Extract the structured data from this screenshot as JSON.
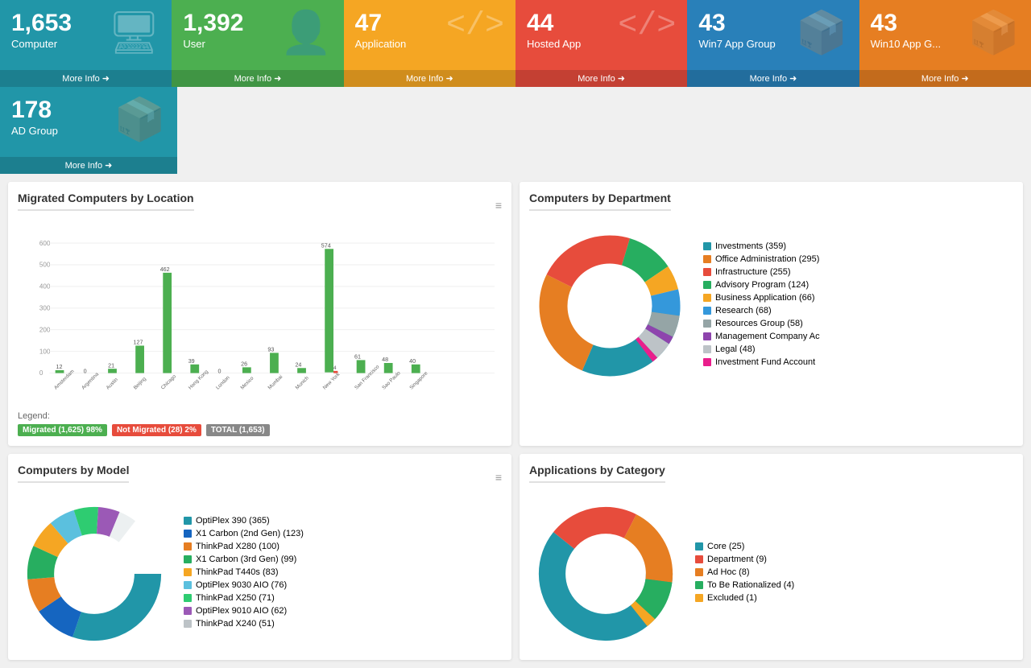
{
  "cards": [
    {
      "id": "computer",
      "number": "1,653",
      "label": "Computer",
      "color": "blue",
      "icon": "🖥",
      "more": "More Info"
    },
    {
      "id": "user",
      "number": "1,392",
      "label": "User",
      "color": "green",
      "icon": "👤",
      "more": "More Info"
    },
    {
      "id": "application",
      "number": "47",
      "label": "Application",
      "color": "yellow",
      "icon": "</>",
      "more": "More Info"
    },
    {
      "id": "hosted-app",
      "number": "44",
      "label": "Hosted App",
      "color": "red",
      "icon": "</>",
      "more": "More Info"
    },
    {
      "id": "win7",
      "number": "43",
      "label": "Win7 App Group",
      "color": "teal",
      "icon": "📦",
      "more": "More Info"
    },
    {
      "id": "win10",
      "number": "43",
      "label": "Win10 App G...",
      "color": "orange",
      "icon": "📦",
      "more": "More Info"
    }
  ],
  "card_wide": {
    "number": "178",
    "label": "AD Group",
    "icon": "📦",
    "more": "More Info"
  },
  "migrated_chart": {
    "title": "Migrated Computers by Location",
    "bars": [
      {
        "location": "Amsterdam",
        "migrated": 12,
        "not_migrated": 0
      },
      {
        "location": "Argentina",
        "migrated": 0,
        "not_migrated": 0
      },
      {
        "location": "Austin",
        "migrated": 21,
        "not_migrated": 0
      },
      {
        "location": "Beijing",
        "migrated": 127,
        "not_migrated": 0
      },
      {
        "location": "Chicago",
        "migrated": 462,
        "not_migrated": 0
      },
      {
        "location": "Hong Kong",
        "migrated": 39,
        "not_migrated": 0
      },
      {
        "location": "London",
        "migrated": 0,
        "not_migrated": 0
      },
      {
        "location": "Mexico",
        "migrated": 26,
        "not_migrated": 0
      },
      {
        "location": "Mumbai",
        "migrated": 93,
        "not_migrated": 0
      },
      {
        "location": "Munich",
        "migrated": 24,
        "not_migrated": 0
      },
      {
        "location": "New York",
        "migrated": 574,
        "not_migrated": 4
      },
      {
        "location": "San Francisco",
        "migrated": 61,
        "not_migrated": 0
      },
      {
        "location": "Sao Paulo",
        "migrated": 48,
        "not_migrated": 0
      },
      {
        "location": "Singapore",
        "migrated": 40,
        "not_migrated": 0
      }
    ],
    "legend": {
      "label": "Legend:",
      "items": [
        {
          "text": "Migrated (1,625)  98%",
          "color": "green"
        },
        {
          "text": "Not Migrated (28)  2%",
          "color": "red"
        },
        {
          "text": "TOTAL (1,653)",
          "color": "gray"
        }
      ]
    }
  },
  "dept_chart": {
    "title": "Computers by Department",
    "segments": [
      {
        "label": "Investments (359)",
        "color": "#2196a8",
        "value": 359
      },
      {
        "label": "Office Administration (295)",
        "color": "#e67e22",
        "value": 295
      },
      {
        "label": "Infrastructure (255)",
        "color": "#e74c3c",
        "value": 255
      },
      {
        "label": "Advisory Program (124)",
        "color": "#27ae60",
        "value": 124
      },
      {
        "label": "Business Application (66)",
        "color": "#f5a623",
        "value": 66
      },
      {
        "label": "Research (68)",
        "color": "#3498db",
        "value": 68
      },
      {
        "label": "Resources Group (58)",
        "color": "#95a5a6",
        "value": 58
      },
      {
        "label": "Management Company Ac",
        "color": "#8e44ad",
        "value": 20
      },
      {
        "label": "Legal (48)",
        "color": "#bdc3c7",
        "value": 48
      },
      {
        "label": "Investment Fund Account",
        "color": "#e91e8c",
        "value": 15
      }
    ]
  },
  "model_chart": {
    "title": "Computers by Model",
    "segments": [
      {
        "label": "OptiPlex 390 (365)",
        "color": "#2196a8",
        "value": 365
      },
      {
        "label": "X1 Carbon (2nd Gen) (123)",
        "color": "#1565c0",
        "value": 123
      },
      {
        "label": "ThinkPad X280 (100)",
        "color": "#e67e22",
        "value": 100
      },
      {
        "label": "X1 Carbon (3rd Gen) (99)",
        "color": "#27ae60",
        "value": 99
      },
      {
        "label": "ThinkPad T440s (83)",
        "color": "#f5a623",
        "value": 83
      },
      {
        "label": "OptiPlex 9030 AIO (76)",
        "color": "#5bc0de",
        "value": 76
      },
      {
        "label": "ThinkPad X250 (71)",
        "color": "#2ecc71",
        "value": 71
      },
      {
        "label": "OptiPlex 9010 AIO (62)",
        "color": "#9b59b6",
        "value": 62
      },
      {
        "label": "ThinkPad X240 (51)",
        "color": "#ecf0f1",
        "value": 51
      }
    ]
  },
  "app_chart": {
    "title": "Applications by Category",
    "segments": [
      {
        "label": "Core (25)",
        "color": "#2196a8",
        "value": 25
      },
      {
        "label": "Department (9)",
        "color": "#e74c3c",
        "value": 9
      },
      {
        "label": "Ad Hoc (8)",
        "color": "#e67e22",
        "value": 8
      },
      {
        "label": "To Be Rationalized (4)",
        "color": "#27ae60",
        "value": 4
      },
      {
        "label": "Excluded (1)",
        "color": "#f5a623",
        "value": 1
      }
    ]
  }
}
